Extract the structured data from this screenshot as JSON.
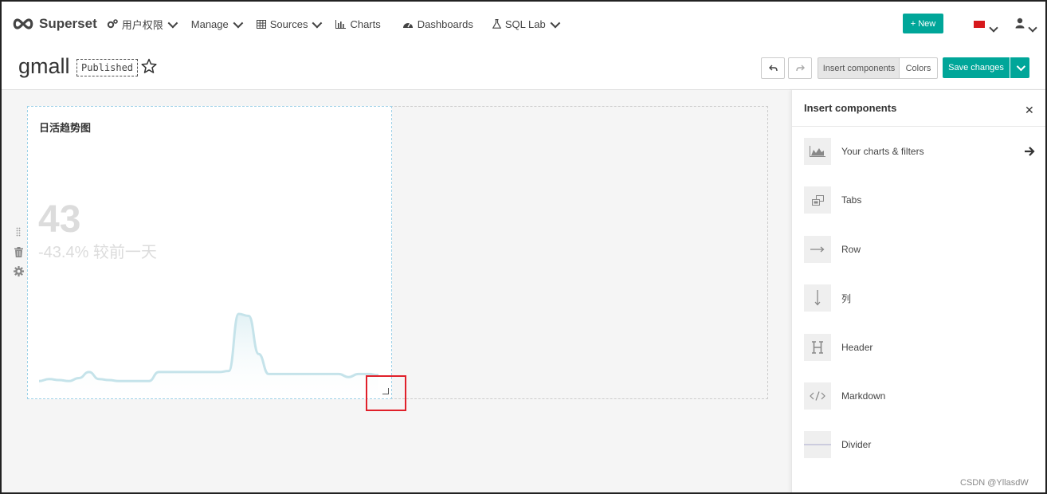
{
  "navbar": {
    "brand": "Superset",
    "items": [
      {
        "label": "用户权限",
        "icon": "cogs-icon",
        "caret": true
      },
      {
        "label": "Manage",
        "icon": "",
        "caret": true
      },
      {
        "label": "Sources",
        "icon": "table-icon",
        "caret": true
      },
      {
        "label": "Charts",
        "icon": "bar-chart-icon",
        "caret": false
      },
      {
        "label": "Dashboards",
        "icon": "dashboard-icon",
        "caret": false
      },
      {
        "label": "SQL Lab",
        "icon": "flask-icon",
        "caret": true
      }
    ],
    "new_label": "+ New",
    "accent": "#00a699"
  },
  "header": {
    "title": "gmall",
    "status": "Published",
    "undo_icon": "undo-icon",
    "redo_icon": "redo-icon",
    "insert_components": "Insert components",
    "colors": "Colors",
    "save_changes": "Save changes"
  },
  "chart": {
    "title": "日活趋势图",
    "big_number": "43",
    "subheader": "-43.4% 较前一天"
  },
  "chart_data": {
    "type": "area",
    "title": "",
    "xlabel": "",
    "ylabel": "",
    "values": [
      3,
      5,
      4,
      3,
      6,
      12,
      5,
      4,
      3,
      3,
      3,
      3,
      12,
      12,
      12,
      12,
      12,
      12,
      12,
      13,
      70,
      68,
      30,
      10,
      10,
      10,
      10,
      10,
      10,
      10,
      10,
      7,
      10,
      10,
      9
    ],
    "color": "#c5e3ea"
  },
  "sidebar": {
    "title": "Insert components",
    "items": [
      {
        "label": "Your charts & filters",
        "icon": "area-chart-icon"
      },
      {
        "label": "Tabs",
        "icon": "tabs-icon"
      },
      {
        "label": "Row",
        "icon": "arrow-right-icon"
      },
      {
        "label": "列",
        "icon": "arrow-down-icon"
      },
      {
        "label": "Header",
        "icon": "header-icon"
      },
      {
        "label": "Markdown",
        "icon": "code-icon"
      },
      {
        "label": "Divider",
        "icon": "divider-icon"
      }
    ]
  },
  "watermark": "CSDN @YllasdW"
}
